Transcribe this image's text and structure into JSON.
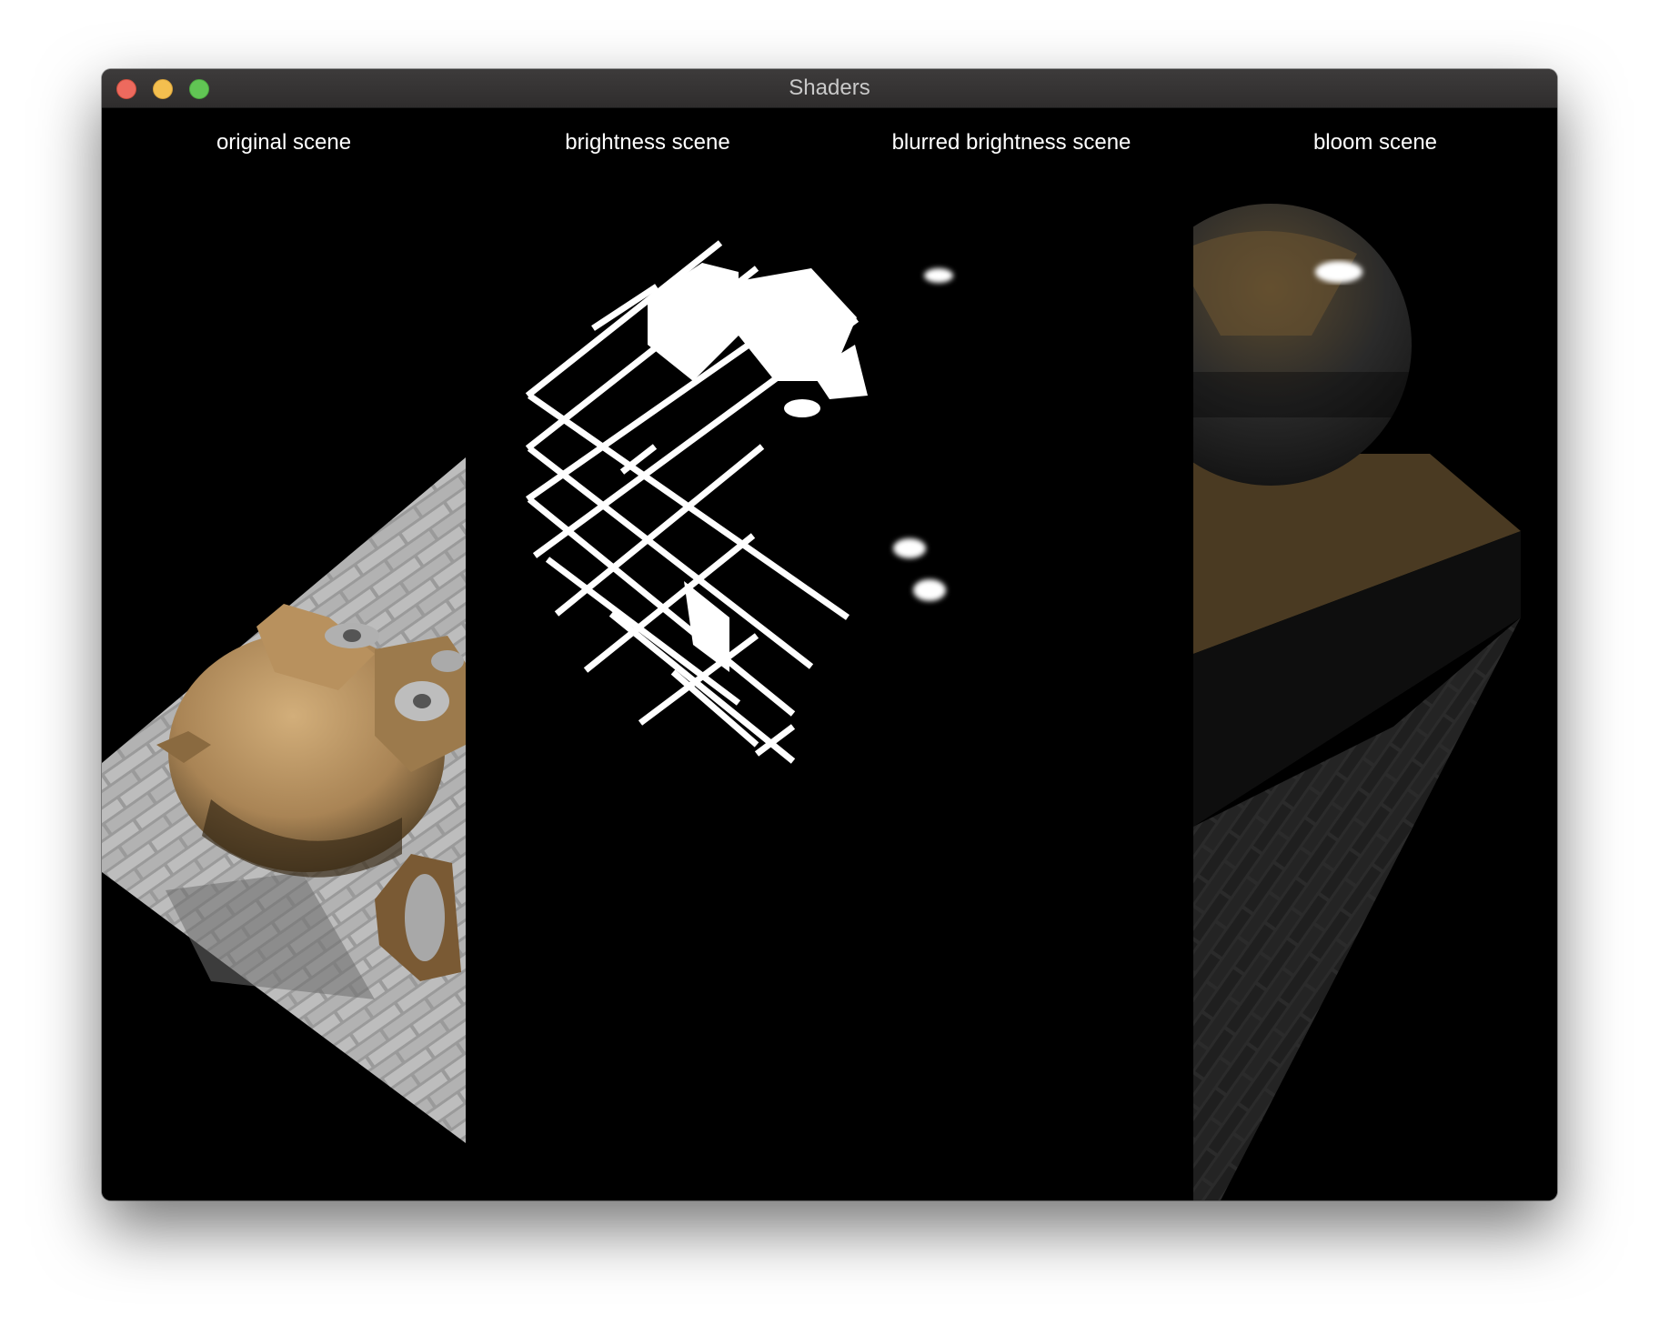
{
  "window": {
    "title": "Shaders"
  },
  "panels": [
    {
      "label": "original scene"
    },
    {
      "label": "brightness scene"
    },
    {
      "label": "blurred brightness scene"
    },
    {
      "label": "bloom scene"
    }
  ],
  "colors": {
    "titlebar": "#3a3838",
    "close": "#ed6a5e",
    "minimize": "#f4bf4f",
    "maximize": "#61c554",
    "background": "#000000",
    "label_text": "#ffffff",
    "monkey_skin": "#b08a5a"
  }
}
